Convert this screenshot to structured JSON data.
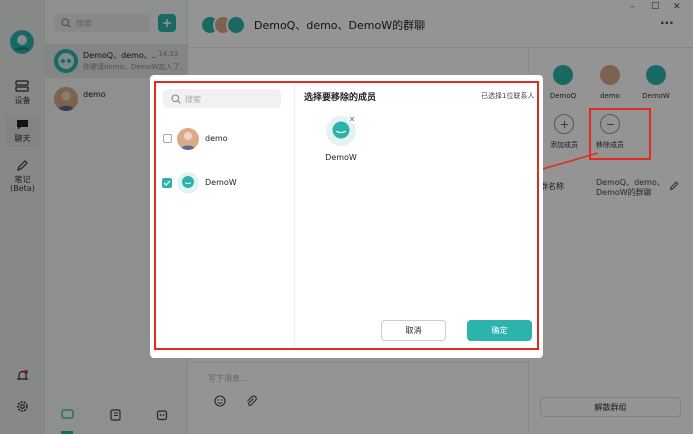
{
  "sidebar_nav": {
    "devices_label": "设备",
    "chat_label": "聊天",
    "notes_label": "笔记",
    "notes_beta_label": "(Beta)"
  },
  "chat_list": {
    "search_placeholder": "搜索",
    "conversations": [
      {
        "name": "DemoQ、demo、...",
        "time": "14:33",
        "preview": "你邀请demo、DemoW加入了..."
      },
      {
        "name": "demo",
        "time": "",
        "preview": ""
      }
    ]
  },
  "chat_header": {
    "title": "DemoQ、demo、DemoW的群聊",
    "more_icon_text": "···"
  },
  "window_controls": {
    "minimize": "–",
    "maximize": "□",
    "close": "✕"
  },
  "composer": {
    "placeholder": "写下消息..."
  },
  "group_panel": {
    "members": [
      {
        "name": "DemoQ"
      },
      {
        "name": "demo"
      },
      {
        "name": "DemoW"
      }
    ],
    "add_member_label": "添加成员",
    "remove_member_label": "移除成员",
    "group_name_label": "群名称",
    "group_name_value_line1": "DemoQ、demo、",
    "group_name_value_line2": "DemoW的群聊",
    "dissolve_label": "解散群组"
  },
  "dialog": {
    "search_placeholder": "搜索",
    "contacts": [
      {
        "name": "demo",
        "checked": false
      },
      {
        "name": "DemoW",
        "checked": true
      }
    ],
    "title": "选择要移除的成员",
    "selected_count_text": "已选择1位联系人",
    "selected_members": [
      {
        "name": "DemoW"
      }
    ],
    "cancel_label": "取消",
    "confirm_label": "确定"
  },
  "colors": {
    "accent": "#2bb3ac",
    "annotation_red": "#e02b20",
    "sidebar_bg": "#e9eceb"
  }
}
